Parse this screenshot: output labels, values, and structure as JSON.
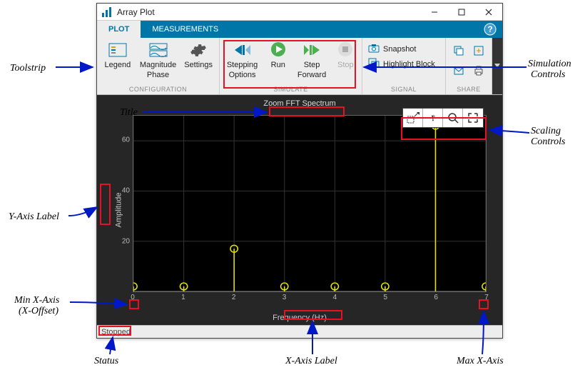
{
  "window": {
    "title": "Array Plot"
  },
  "tabs": {
    "plot": "PLOT",
    "measurements": "MEASUREMENTS"
  },
  "toolstrip": {
    "config": {
      "legend": "Legend",
      "magphase_line1": "Magnitude",
      "magphase_line2": "Phase",
      "settings": "Settings",
      "section": "CONFIGURATION"
    },
    "simulate": {
      "stepping_line1": "Stepping",
      "stepping_line2": "Options",
      "run": "Run",
      "stepfwd_line1": "Step",
      "stepfwd_line2": "Forward",
      "stop": "Stop",
      "section": "SIMULATE"
    },
    "signal": {
      "snapshot": "Snapshot",
      "highlight": "Highlight Block",
      "section": "SIGNAL"
    },
    "share": {
      "section": "SHARE"
    }
  },
  "chart_data": {
    "type": "bar",
    "title": "Zoom FFT Spectrum",
    "xlabel": "Frequency (Hz)",
    "ylabel": "Amplitude",
    "ylim": [
      0,
      70
    ],
    "xlim": [
      0,
      7
    ],
    "xticks": [
      0,
      1,
      2,
      3,
      4,
      5,
      6,
      7
    ],
    "yticks": [
      20,
      40,
      60
    ],
    "x": [
      0,
      1,
      2,
      3,
      4,
      5,
      6,
      7
    ],
    "y": [
      2,
      2,
      17,
      2,
      2,
      2,
      66,
      2
    ]
  },
  "status": {
    "state": "Stopped"
  },
  "annotations": {
    "toolstrip": "Toolstrip",
    "title": "Title",
    "yaxis": "Y-Axis Label",
    "minx_line1": "Min X-Axis",
    "minx_line2": "(X-Offset)",
    "status": "Status",
    "xaxis": "X-Axis Label",
    "maxx": "Max X-Axis",
    "scale_line1": "Scaling",
    "scale_line2": "Controls",
    "sim_line1": "Simulation",
    "sim_line2": "Controls"
  }
}
